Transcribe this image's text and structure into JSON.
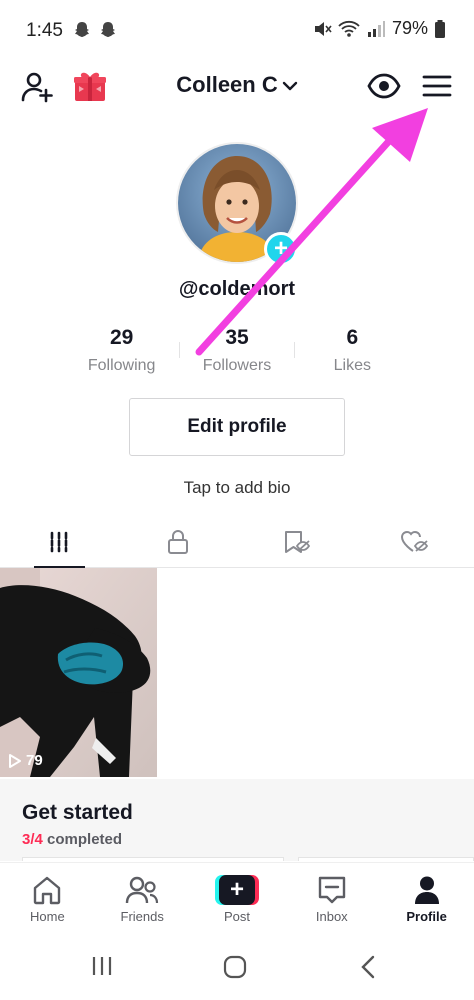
{
  "status_bar": {
    "time": "1:45",
    "battery": "79%"
  },
  "header": {
    "title": "Colleen C"
  },
  "profile": {
    "username": "@coldemort",
    "stats": [
      {
        "value": "29",
        "label": "Following"
      },
      {
        "value": "35",
        "label": "Followers"
      },
      {
        "value": "6",
        "label": "Likes"
      }
    ],
    "edit_button": "Edit profile",
    "bio_prompt": "Tap to add bio"
  },
  "video": {
    "views": "79"
  },
  "get_started": {
    "title": "Get started",
    "progress_count": "3/4",
    "progress_text": "completed"
  },
  "bottom_nav": [
    {
      "label": "Home",
      "icon": "home-icon"
    },
    {
      "label": "Friends",
      "icon": "friends-icon"
    },
    {
      "label": "Post",
      "icon": "post-icon"
    },
    {
      "label": "Inbox",
      "icon": "inbox-icon"
    },
    {
      "label": "Profile",
      "icon": "profile-icon"
    }
  ],
  "colors": {
    "accent_cyan": "#20d5ec",
    "accent_pink": "#fe2c55",
    "annotation_arrow": "#f23fe0",
    "text_primary": "#161823",
    "text_secondary": "#86878b"
  }
}
